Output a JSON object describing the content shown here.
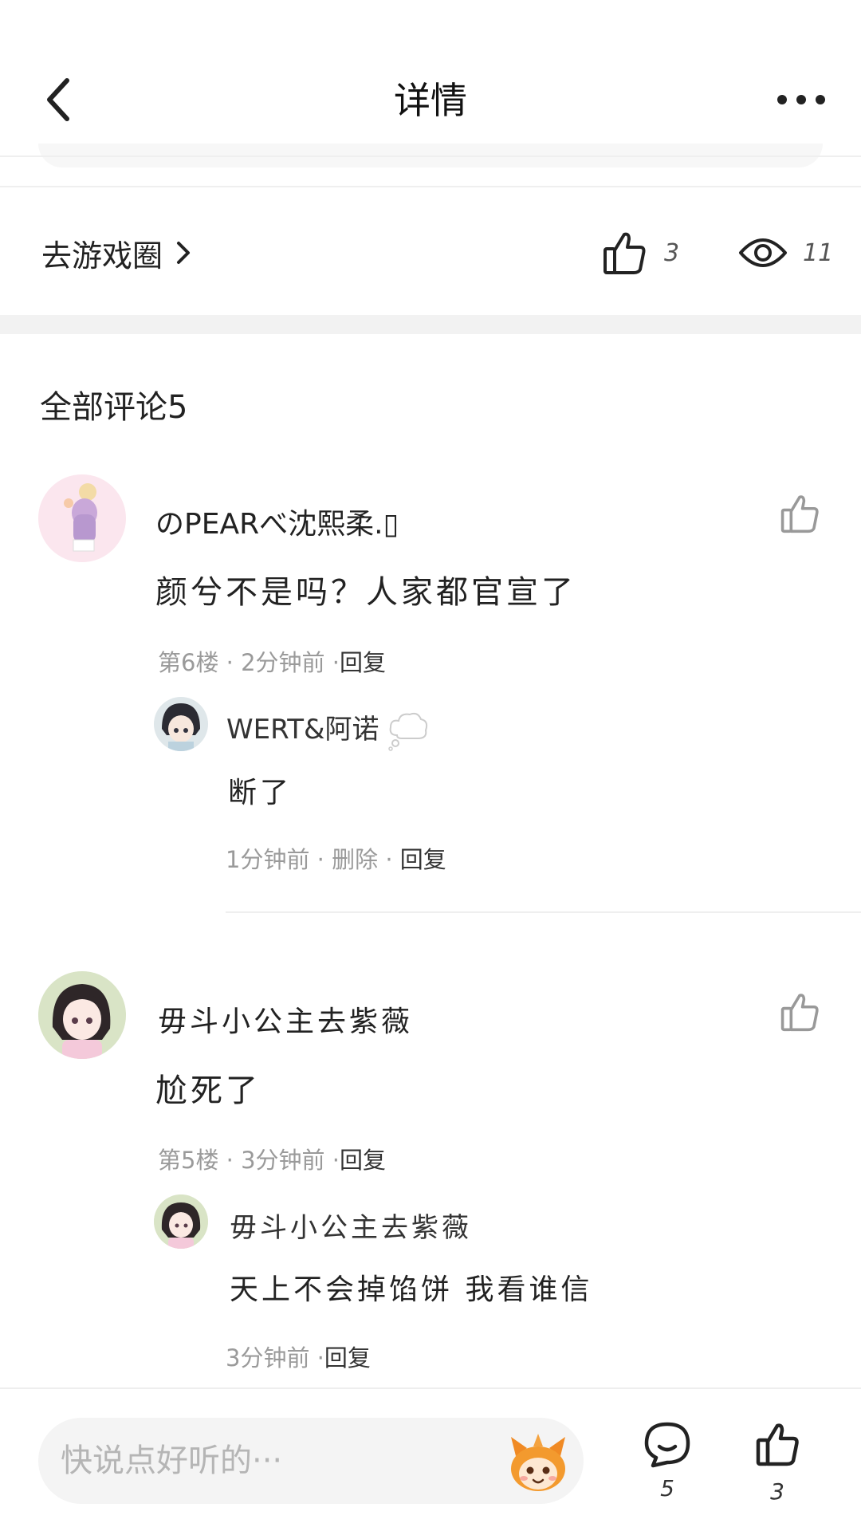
{
  "header": {
    "title": "详情"
  },
  "stats": {
    "circle_link_label": "去游戏圈",
    "like_count": "3",
    "view_count": "11"
  },
  "comments_heading": "全部评论5",
  "comments": [
    {
      "user": "のPEARべ沈熙柔.▯",
      "text": "颜兮不是吗？人家都官宣了",
      "floor": "第6楼",
      "time": "2分钟前",
      "reply_label": "回复",
      "reply": {
        "user": "WERT&阿诺",
        "badge": "thought-bubble",
        "text": "断了",
        "time": "1分钟前",
        "delete_label": "删除",
        "reply_label": "回复"
      }
    },
    {
      "user": "毋斗小公主去紫薇",
      "text": "尬死了",
      "floor": "第5楼",
      "time": "3分钟前",
      "reply_label": "回复",
      "reply": {
        "user": "毋斗小公主去紫薇",
        "text": "天上不会掉馅饼  我看谁信",
        "time": "3分钟前",
        "reply_label": "回复"
      }
    }
  ],
  "bottom_bar": {
    "input_placeholder": "快说点好听的···",
    "comment_count": "5",
    "like_count": "3"
  },
  "icons": {
    "back": "chevron-left-icon",
    "more": "more-dots-icon",
    "like": "thumbs-up-icon",
    "view": "eye-icon",
    "comment": "chat-bubble-icon",
    "emoji": "mascot-emoji-icon"
  }
}
